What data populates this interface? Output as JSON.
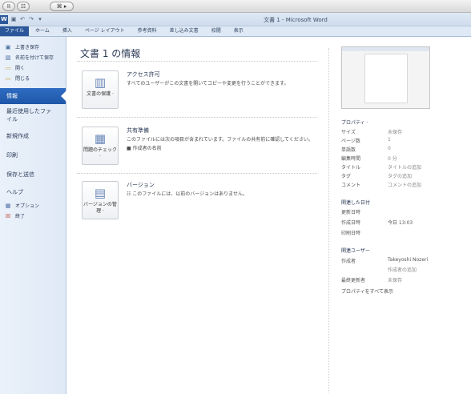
{
  "remote_toolbar": {
    "pause_label": "II",
    "screen_label": "☷",
    "keys_label": "⌘ ▸"
  },
  "window": {
    "title": "文書 1 - Microsoft Word"
  },
  "ribbon_tabs": [
    {
      "label": "ファイル"
    },
    {
      "label": "ホーム"
    },
    {
      "label": "挿入"
    },
    {
      "label": "ページ レイアウト"
    },
    {
      "label": "参考資料"
    },
    {
      "label": "差し込み文書"
    },
    {
      "label": "校閲"
    },
    {
      "label": "表示"
    }
  ],
  "nav": {
    "commands": [
      {
        "label": "上書き保存",
        "icon": "save-icon",
        "glyph": "▣"
      },
      {
        "label": "名前を付けて保存",
        "icon": "save-as-icon",
        "glyph": "▧"
      },
      {
        "label": "開く",
        "icon": "open-folder-icon",
        "glyph": "▭"
      },
      {
        "label": "閉じる",
        "icon": "close-folder-icon",
        "glyph": "▭"
      }
    ],
    "info": "情報",
    "recent": "最近使用したファイル",
    "new": "新規作成",
    "print": "印刷",
    "save_send": "保存と送信",
    "help": "ヘルプ",
    "options": "オプション",
    "exit": "終了"
  },
  "main": {
    "title": "文書 1 の情報",
    "sections": [
      {
        "button_label": "文書の保護 ·",
        "icon": "lock-document-icon",
        "glyph": "▥",
        "heading": "アクセス許可",
        "description": "すべてのユーザーがこの文書を開いてコピーや変更を行うことができます。",
        "sub": ""
      },
      {
        "button_label": "問題のチェック ·",
        "icon": "check-document-icon",
        "glyph": "▦",
        "heading": "共有準備",
        "description": "このファイルには次の項目が含まれています。ファイルの共有前に確認してください。",
        "sub": "■  作成者の名前"
      },
      {
        "button_label": "バージョンの管理 ·",
        "icon": "manage-versions-icon",
        "glyph": "▤",
        "heading": "バージョン",
        "description": "☷  このファイルには、以前のバージョンはありません。",
        "sub": ""
      }
    ]
  },
  "properties": {
    "heading": "プロパティ ·",
    "rows": [
      {
        "key": "サイズ",
        "value": "未保存"
      },
      {
        "key": "ページ数",
        "value": "1"
      },
      {
        "key": "単語数",
        "value": "0"
      },
      {
        "key": "編集時間",
        "value": "0 分"
      },
      {
        "key": "タイトル",
        "value": "タイトルの追加"
      },
      {
        "key": "タグ",
        "value": "タグの追加"
      },
      {
        "key": "コメント",
        "value": "コメントの追加"
      }
    ],
    "dates_heading": "関連した日付",
    "dates": [
      {
        "key": "更新日時",
        "value": ""
      },
      {
        "key": "作成日時",
        "value": "今日 13:03"
      },
      {
        "key": "印刷日時",
        "value": ""
      }
    ],
    "people_heading": "関連ユーザー",
    "author_key": "作成者",
    "author_value": "Takeyoshi Nozeri",
    "add_author": "作成者の追加",
    "last_modified_key": "最終更新者",
    "last_modified_value": "未保存",
    "show_all": "プロパティをすべて表示"
  }
}
